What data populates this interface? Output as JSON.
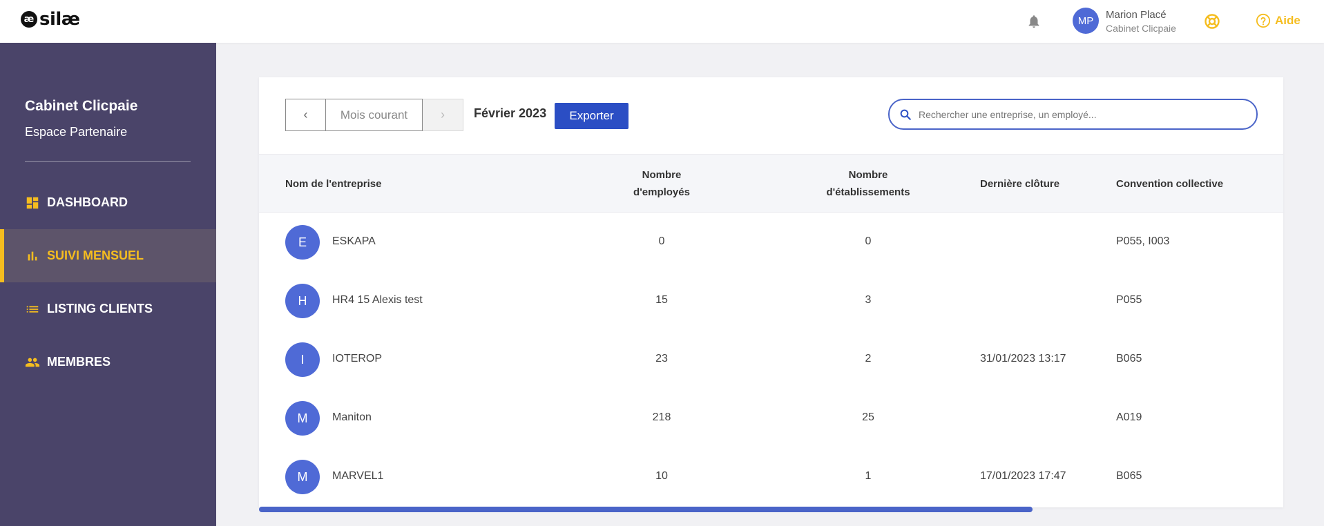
{
  "brand": {
    "mark": "æ",
    "name": "silæ"
  },
  "header": {
    "user_initials": "MP",
    "user_name": "Marion Placé",
    "user_org": "Cabinet Clicpaie",
    "help_label": "Aide"
  },
  "sidebar": {
    "title": "Cabinet Clicpaie",
    "subtitle": "Espace Partenaire",
    "items": [
      {
        "label": "DASHBOARD",
        "icon": "dashboard-icon",
        "active": false
      },
      {
        "label": "SUIVI MENSUEL",
        "icon": "bar-chart-icon",
        "active": true
      },
      {
        "label": "LISTING CLIENTS",
        "icon": "list-icon",
        "active": false
      },
      {
        "label": "MEMBRES",
        "icon": "people-icon",
        "active": false
      }
    ]
  },
  "toolbar": {
    "prev_label": "‹",
    "current_label": "Mois courant",
    "next_label": "›",
    "period": "Février 2023",
    "export_label": "Exporter",
    "search_placeholder": "Rechercher une entreprise, un employé..."
  },
  "table": {
    "headers": {
      "company": "Nom de l'entreprise",
      "employees_l1": "Nombre",
      "employees_l2": "d'employés",
      "establishments_l1": "Nombre",
      "establishments_l2": "d'établissements",
      "last_close": "Dernière clôture",
      "convention": "Convention collective"
    },
    "rows": [
      {
        "initial": "E",
        "name": "ESKAPA",
        "employees": "0",
        "establishments": "0",
        "last_close": "",
        "convention": "P055, I003"
      },
      {
        "initial": "H",
        "name": "HR4 15 Alexis test",
        "employees": "15",
        "establishments": "3",
        "last_close": "",
        "convention": "P055"
      },
      {
        "initial": "I",
        "name": "IOTEROP",
        "employees": "23",
        "establishments": "2",
        "last_close": "31/01/2023 13:17",
        "convention": "B065"
      },
      {
        "initial": "M",
        "name": "Maniton",
        "employees": "218",
        "establishments": "25",
        "last_close": "",
        "convention": "A019"
      },
      {
        "initial": "M",
        "name": "MARVEL1",
        "employees": "10",
        "establishments": "1",
        "last_close": "17/01/2023 17:47",
        "convention": "B065"
      }
    ]
  },
  "colors": {
    "sidebar_bg": "#4a4469",
    "accent_yellow": "#f5bd1f",
    "primary_blue": "#2b4ec4",
    "avatar_blue": "#4f6ad6"
  }
}
